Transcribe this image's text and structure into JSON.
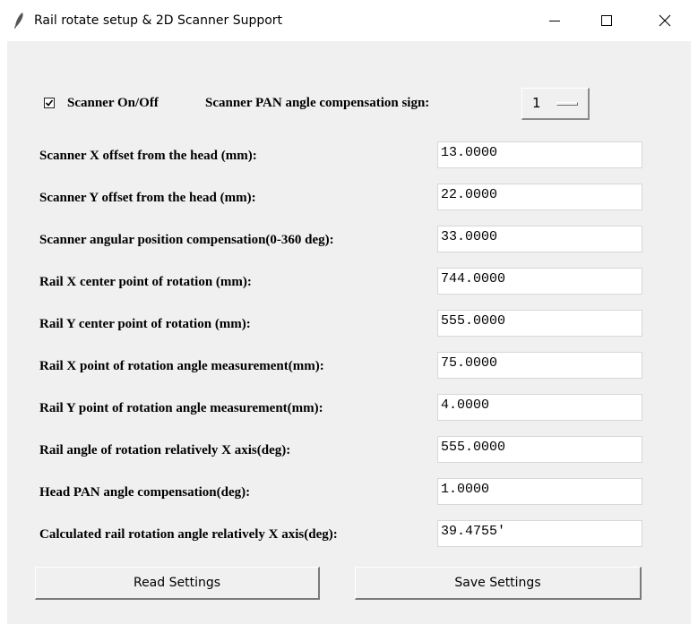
{
  "window": {
    "title": "Rail rotate setup & 2D Scanner Support",
    "icon": "feather-icon",
    "controls": [
      "minimize-icon",
      "maximize-icon",
      "close-icon"
    ]
  },
  "scanner": {
    "checkbox_label": "Scanner On/Off",
    "checked": true,
    "pan_sign_label": "Scanner PAN angle compensation sign:",
    "pan_sign_value": "1"
  },
  "fields": [
    {
      "label": "Scanner X offset from the head (mm):",
      "value": "13.0000"
    },
    {
      "label": "Scanner Y offset from the head (mm):",
      "value": "22.0000"
    },
    {
      "label": "Scanner angular position compensation(0-360 deg):",
      "value": "33.0000"
    },
    {
      "label": "Rail X center point of rotation (mm):",
      "value": "744.0000"
    },
    {
      "label": "Rail Y center point of rotation (mm):",
      "value": "555.0000"
    },
    {
      "label": "Rail X point of rotation angle measurement(mm):",
      "value": "75.0000"
    },
    {
      "label": "Rail Y point of rotation angle measurement(mm):",
      "value": "4.0000"
    },
    {
      "label": "Rail angle of rotation relatively X axis(deg):",
      "value": "555.0000"
    },
    {
      "label": "Head PAN angle compensation(deg):",
      "value": "1.0000"
    },
    {
      "label": "Calculated rail rotation angle relatively X axis(deg):",
      "value": "39.4755'"
    }
  ],
  "buttons": {
    "read": "Read Settings",
    "save": "Save Settings"
  }
}
